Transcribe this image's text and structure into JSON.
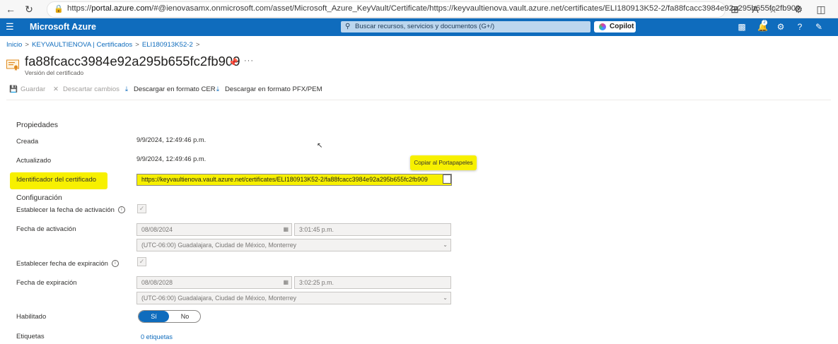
{
  "browser": {
    "url_prefix": "https://",
    "url_domain": "portal.azure.com",
    "url_rest": "/#@ienovasamx.onmicrosoft.com/asset/Microsoft_Azure_KeyVault/Certificate/https://keyvaultienova.vault.azure.net/certificates/ELI180913K52-2/fa88fcacc3984e92a295b655fc2fb909"
  },
  "azure": {
    "brand": "Microsoft Azure",
    "search_placeholder": "Buscar recursos, servicios y documentos (G+/)",
    "copilot_label": "Copilot",
    "notification_count": "2"
  },
  "breadcrumb": [
    "Inicio",
    "KEYVAULTIENOVA | Certificados",
    "ELI180913K52-2"
  ],
  "header": {
    "title": "fa88fcacc3984e92a295b655fc2fb909",
    "subtitle": "Versión del certificado"
  },
  "toolbar": {
    "save": "Guardar",
    "discard": "Descartar cambios",
    "download_cer": "Descargar en formato CER",
    "download_pfx": "Descargar en formato PFX/PEM"
  },
  "properties": {
    "section": "Propiedades",
    "created_label": "Creada",
    "created_value": "9/9/2024, 12:49:46 p.m.",
    "updated_label": "Actualizado",
    "updated_value": "9/9/2024, 12:49:46 p.m.",
    "id_label": "Identificador del certificado",
    "id_value": "https://keyvaultienova.vault.azure.net/certificates/ELI180913K52-2/fa88fcacc3984e92a295b655fc2fb909",
    "copy_tooltip": "Copiar al Portapapeles"
  },
  "config": {
    "section": "Configuración",
    "set_activation_label": "Establecer la fecha de activación",
    "activation_label": "Fecha de activación",
    "activation_date": "08/08/2024",
    "activation_time": "3:01:45 p.m.",
    "activation_tz": "(UTC-06:00) Guadalajara, Ciudad de México, Monterrey",
    "set_expiration_label": "Establecer fecha de expiración",
    "expiration_label": "Fecha de expiración",
    "expiration_date": "08/08/2028",
    "expiration_time": "3:02:25 p.m.",
    "expiration_tz": "(UTC-06:00) Guadalajara, Ciudad de México, Monterrey",
    "enabled_label": "Habilitado",
    "toggle_yes": "Sí",
    "toggle_no": "No",
    "tags_label": "Etiquetas",
    "tags_value": "0 etiquetas"
  },
  "colors": {
    "azure_blue": "#0f6cbd",
    "highlight": "#f7f000"
  }
}
